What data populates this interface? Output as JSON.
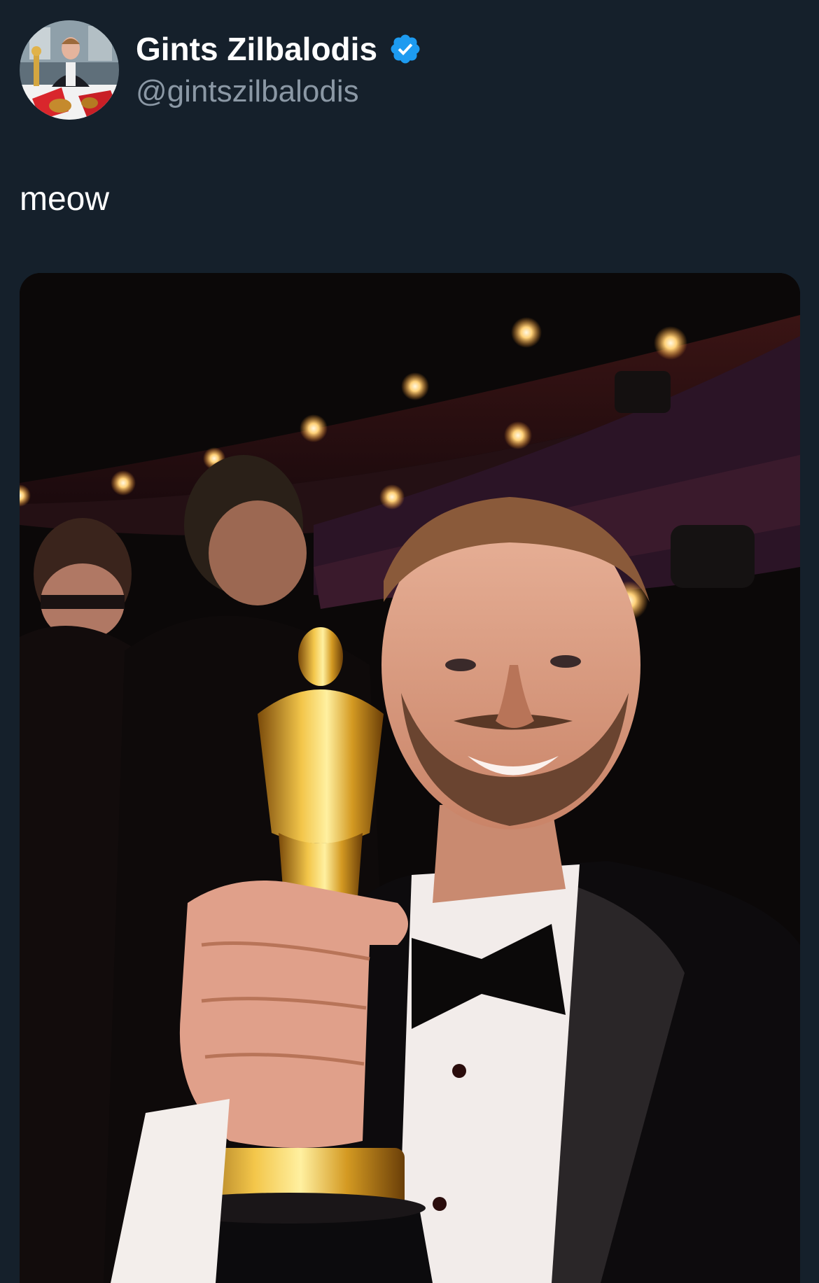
{
  "author": {
    "display_name": "Gints Zilbalodis",
    "handle": "@gintszilbalodis",
    "verified": true,
    "avatar_icon": "profile-photo-avatar",
    "badge_icon": "verified-check-icon"
  },
  "tweet": {
    "text": "meow",
    "media_icon": "photo-selfie-with-golden-statuette"
  },
  "colors": {
    "background": "#15202b",
    "name": "#ffffff",
    "handle": "#8b98a5",
    "verified": "#1d9bf0"
  }
}
